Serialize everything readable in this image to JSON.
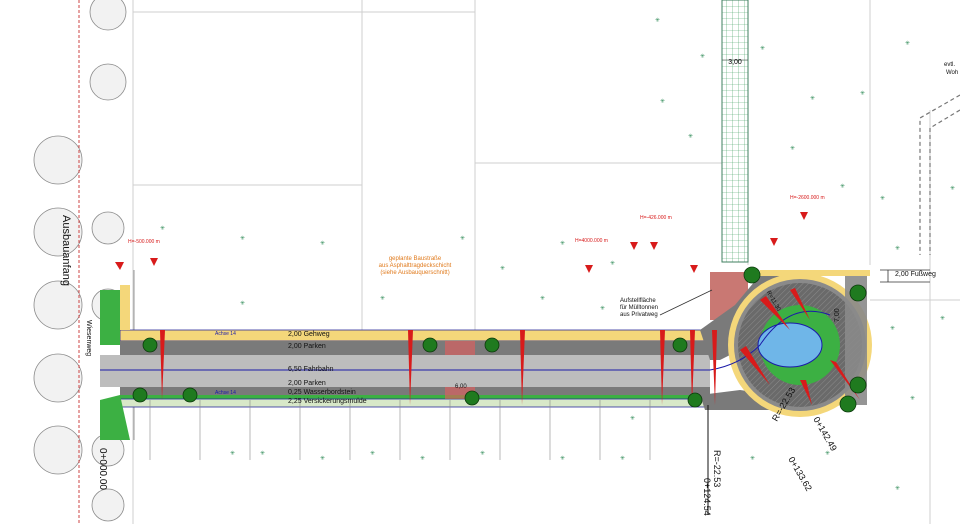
{
  "labels": {
    "ausbauanfang": "Ausbauanfang",
    "wiesenweg": "Wiesenweg",
    "baustrasse_1": "geplante Baustraße",
    "baustrasse_2": "aus Asphalttragdeckschicht",
    "baustrasse_3": "(siehe Ausbauquerschnitt)",
    "aufstell_1": "Aufstellfläche",
    "aufstell_2": "für Mülltonnen",
    "aufstell_3": "aus Privatweg",
    "fussweg": "2,00 Fußweg",
    "gehweg": "2,00  Gehweg",
    "parken_top": "2,00  Parken",
    "fahrbahn": "6,50  Fahrbahn",
    "parken_bottom": "2,00  Parken",
    "wasserbordstein": "0,25  Wasserbordstein",
    "versickerung": "2,25  Versickerungsmulde",
    "width_300": "3,00",
    "width_600": "6,00",
    "width_700": "7,00",
    "evtl": "evtl.",
    "woh": "Woh",
    "achse": "Achse 14",
    "station_start": "0+000.00",
    "station_12454": "0+124.54",
    "station_13362": "0+133.62",
    "station_14249": "0+142.49",
    "radius_2253a": "R=-22.53",
    "radius_2253b": "R=-22.53",
    "radius_1130": "R=11.30",
    "hp_1": "H=-500.000 m",
    "hp_2": "H=4000.000 m",
    "hp_3": "H=-426.000 m",
    "hp_4": "H=-2600.000 m"
  },
  "colors": {
    "gehweg": "#f4d77a",
    "parken": "#7a7a7a",
    "fahrbahn": "#bdbdbd",
    "asphalt_edge": "#2b2b9a",
    "green": "#3cb043",
    "tree": "#1f7a1f",
    "water": "#6fb6e8",
    "axis": "#1a1aa8",
    "annotation": "#d81b1b",
    "construction": "#e07a1c",
    "private_way": "#c0605a"
  }
}
